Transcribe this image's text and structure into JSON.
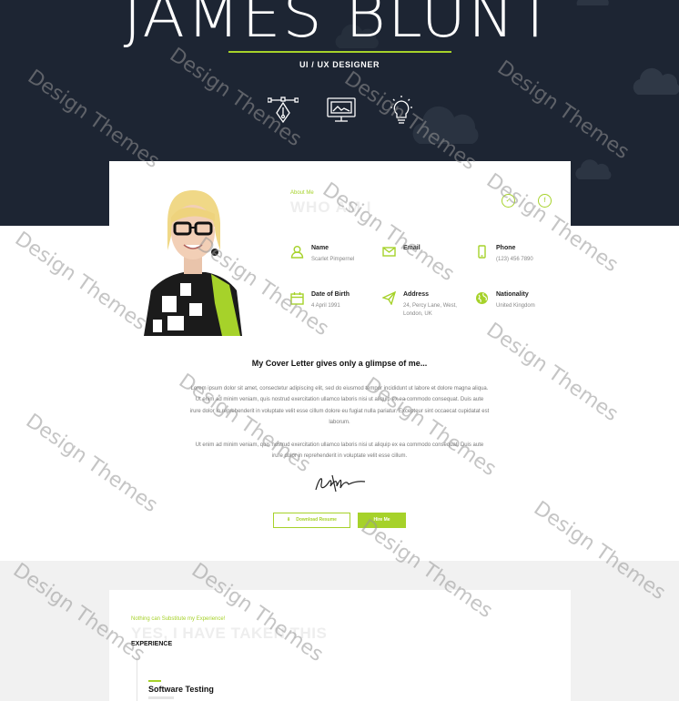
{
  "hero": {
    "name": "JAMES BLUNT",
    "role": "UI / UX DESIGNER",
    "icons": [
      "pen-tool-icon",
      "monitor-icon",
      "lightbulb-icon"
    ],
    "colors": {
      "background": "#1d2533",
      "accent": "#a6d22a"
    }
  },
  "about": {
    "kicker": "About Me",
    "heading": "WHO AM I",
    "social_icons": [
      "twitter-icon",
      "facebook-icon"
    ],
    "fields": [
      {
        "icon": "user-icon",
        "label": "Name",
        "value": "Scarlet Pimpernel"
      },
      {
        "icon": "envelope-icon",
        "label": "Email",
        "value": ""
      },
      {
        "icon": "phone-icon",
        "label": "Phone",
        "value": "(123) 456 7890"
      },
      {
        "icon": "calendar-icon",
        "label": "Date of Birth",
        "value": "4 April 1991"
      },
      {
        "icon": "paper-plane-icon",
        "label": "Address",
        "value": "24, Percy Lane, West, London, UK"
      },
      {
        "icon": "globe-icon",
        "label": "Nationality",
        "value": "United Kingdom"
      }
    ]
  },
  "cover": {
    "title": "My Cover Letter gives only a glimpse of me...",
    "paragraph1": "Lorem ipsum dolor sit amet, consectetur adipiscing elit, sed do eiusmod tempor incididunt ut labore et dolore magna aliqua. Ut enim ad minim veniam, quis nostrud exercitation ullamco laboris nisi ut aliquip ex ea commodo consequat. Duis aute irure dolor in reprehenderit in voluptate velit esse cillum dolore eu fugiat nulla pariatur. Excepteur sint occaecat cupidatat est laborum.",
    "paragraph2": "Ut enim ad minim veniam, quis nostrud exercitation ullamco laboris nisi ut aliquip ex ea commodo consequat. Duis aute irure dolor in reprehenderit in voluptate velit esse cillum.",
    "download_label": "Download Resume",
    "hire_label": "Hire Me"
  },
  "experience": {
    "kicker": "Nothing can Substitute my Experience!",
    "heading": "YES, I HAVE TAKEN THIS",
    "label": "EXPERIENCE",
    "jobs": [
      {
        "title": "Software Testing"
      }
    ]
  },
  "watermark": "Design Themes"
}
